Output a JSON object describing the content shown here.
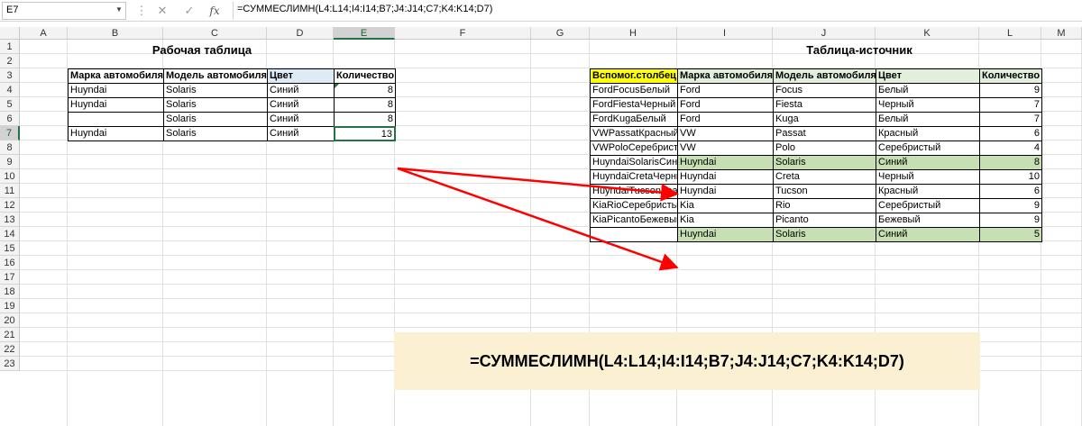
{
  "formula_bar": {
    "name_box": "E7",
    "formula": "=СУММЕСЛИМН(L4:L14;I4:I14;B7;J4:J14;C7;K4:K14;D7)",
    "icons": [
      "dropdown-icon",
      "more-icon",
      "cancel-icon",
      "enter-icon",
      "function-icon"
    ],
    "fx_label": "fx"
  },
  "columns": [
    "A",
    "B",
    "C",
    "D",
    "E",
    "F",
    "G",
    "H",
    "I",
    "J",
    "K",
    "L",
    "M"
  ],
  "rows": [
    "1",
    "2",
    "3",
    "4",
    "5",
    "6",
    "7",
    "8",
    "9",
    "10",
    "11",
    "12",
    "13",
    "14",
    "15",
    "16",
    "17",
    "18",
    "19",
    "20",
    "21",
    "22",
    "23"
  ],
  "selected_cell": {
    "column": "E",
    "row": "7"
  },
  "work_table": {
    "title": "Рабочая таблица",
    "title_color": "#2e75b6",
    "headers": [
      "Марка автомобиля",
      "Модель автомобиля",
      "Цвет",
      "Количество"
    ],
    "header_highlight": "#ddebf7",
    "rows": [
      [
        "Huyndai",
        "Solaris",
        "Синий",
        "8"
      ],
      [
        "Huyndai",
        "Solaris",
        "Синий",
        "8"
      ],
      [
        "",
        "Solaris",
        "Синий",
        "8"
      ],
      [
        "Huyndai",
        "Solaris",
        "Синий",
        "13"
      ]
    ]
  },
  "source_table": {
    "title": "Таблица-источник",
    "title_color": "#548235",
    "headers": [
      "Вспомог.столбец",
      "Марка автомобиля",
      "Модель автомобиля",
      "Цвет",
      "Количество"
    ],
    "helper_header_color": "#ffff00",
    "header_color": "#e2efda",
    "match_row_color": "#c6e0b4",
    "rows": [
      [
        "FordFocusБелый",
        "Ford",
        "Focus",
        "Белый",
        "9"
      ],
      [
        "FordFiestaЧерный",
        "Ford",
        "Fiesta",
        "Черный",
        "7"
      ],
      [
        "FordKugaБелый",
        "Ford",
        "Kuga",
        "Белый",
        "7"
      ],
      [
        "VWPassatКрасный",
        "VW",
        "Passat",
        "Красный",
        "6"
      ],
      [
        "VWPoloСеребристый",
        "VW",
        "Polo",
        "Серебристый",
        "4"
      ],
      [
        "HuyndaiSolarisСиний",
        "Huyndai",
        "Solaris",
        "Синий",
        "8"
      ],
      [
        "HuyndaiCretaЧерный",
        "Huyndai",
        "Creta",
        "Черный",
        "10"
      ],
      [
        "HuyndaiTucsonКрасный",
        "Huyndai",
        "Tucson",
        "Красный",
        "6"
      ],
      [
        "KiaRioСеребристый",
        "Kia",
        "Rio",
        "Серебристый",
        "9"
      ],
      [
        "KiaPicantoБежевый",
        "Kia",
        "Picanto",
        "Бежевый",
        "9"
      ],
      [
        "",
        "Huyndai",
        "Solaris",
        "Синий",
        "5"
      ]
    ],
    "match_rows": [
      5,
      10
    ]
  },
  "formula_callout": "=СУММЕСЛИМН(L4:L14;I4:I14;B7;J4:J14;C7;K4:K14;D7)",
  "arrow_color": "#ff0000"
}
